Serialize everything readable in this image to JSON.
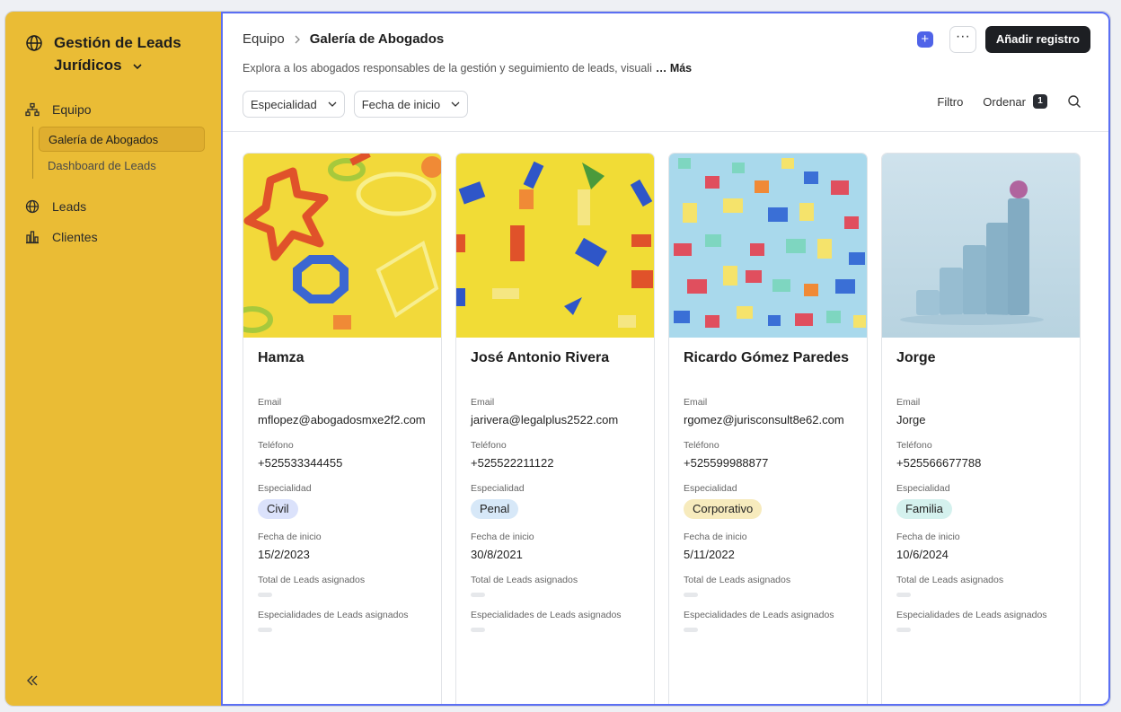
{
  "sidebar": {
    "workspace_title": "Gestión de Leads Jurídicos",
    "items": [
      {
        "label": "Equipo",
        "icon": "org-chart-icon"
      },
      {
        "label": "Leads",
        "icon": "globe-icon"
      },
      {
        "label": "Clientes",
        "icon": "bar-chart-icon"
      }
    ],
    "subitems": [
      {
        "label": "Galería de Abogados",
        "active": true
      },
      {
        "label": "Dashboard de Leads",
        "active": false
      }
    ],
    "bg_color": "#eabc35"
  },
  "header": {
    "breadcrumb_parent": "Equipo",
    "breadcrumb_current": "Galería de Abogados",
    "description": "Explora a los abogados responsables de la gestión y seguimiento de leads, visuali",
    "more_link": "… Más",
    "plus_icon": "+",
    "more_icon": "···",
    "add_button": "Añadir registro"
  },
  "filters": {
    "specialty": "Especialidad",
    "start_date": "Fecha de inicio",
    "filter": "Filtro",
    "sort": "Ordenar",
    "sort_count": "1"
  },
  "labels": {
    "email": "Email",
    "phone": "Teléfono",
    "specialty": "Especialidad",
    "start_date": "Fecha de inicio",
    "total_leads": "Total de Leads asignados",
    "lead_specialties": "Especialidades de Leads asignados"
  },
  "cards": [
    {
      "name": "Hamza",
      "email": "mflopez@abogadosmxe2f2.com",
      "phone": "+525533344455",
      "specialty": "Civil",
      "specialty_color": "#dbe2fb",
      "start_date": "15/2/2023"
    },
    {
      "name": "José Antonio Rivera",
      "email": "jarivera@legalplus2522.com",
      "phone": "+525522211122",
      "specialty": "Penal",
      "specialty_color": "#d7e8f8",
      "start_date": "30/8/2021"
    },
    {
      "name": "Ricardo Gómez Paredes",
      "email": "rgomez@jurisconsult8e62.com",
      "phone": "+525599988877",
      "specialty": "Corporativo",
      "specialty_color": "#f7ebbd",
      "start_date": "5/11/2022"
    },
    {
      "name": "Jorge",
      "email": "Jorge",
      "phone": "+525566677788",
      "specialty": "Familia",
      "specialty_color": "#d4f1ee",
      "start_date": "10/6/2024"
    }
  ]
}
